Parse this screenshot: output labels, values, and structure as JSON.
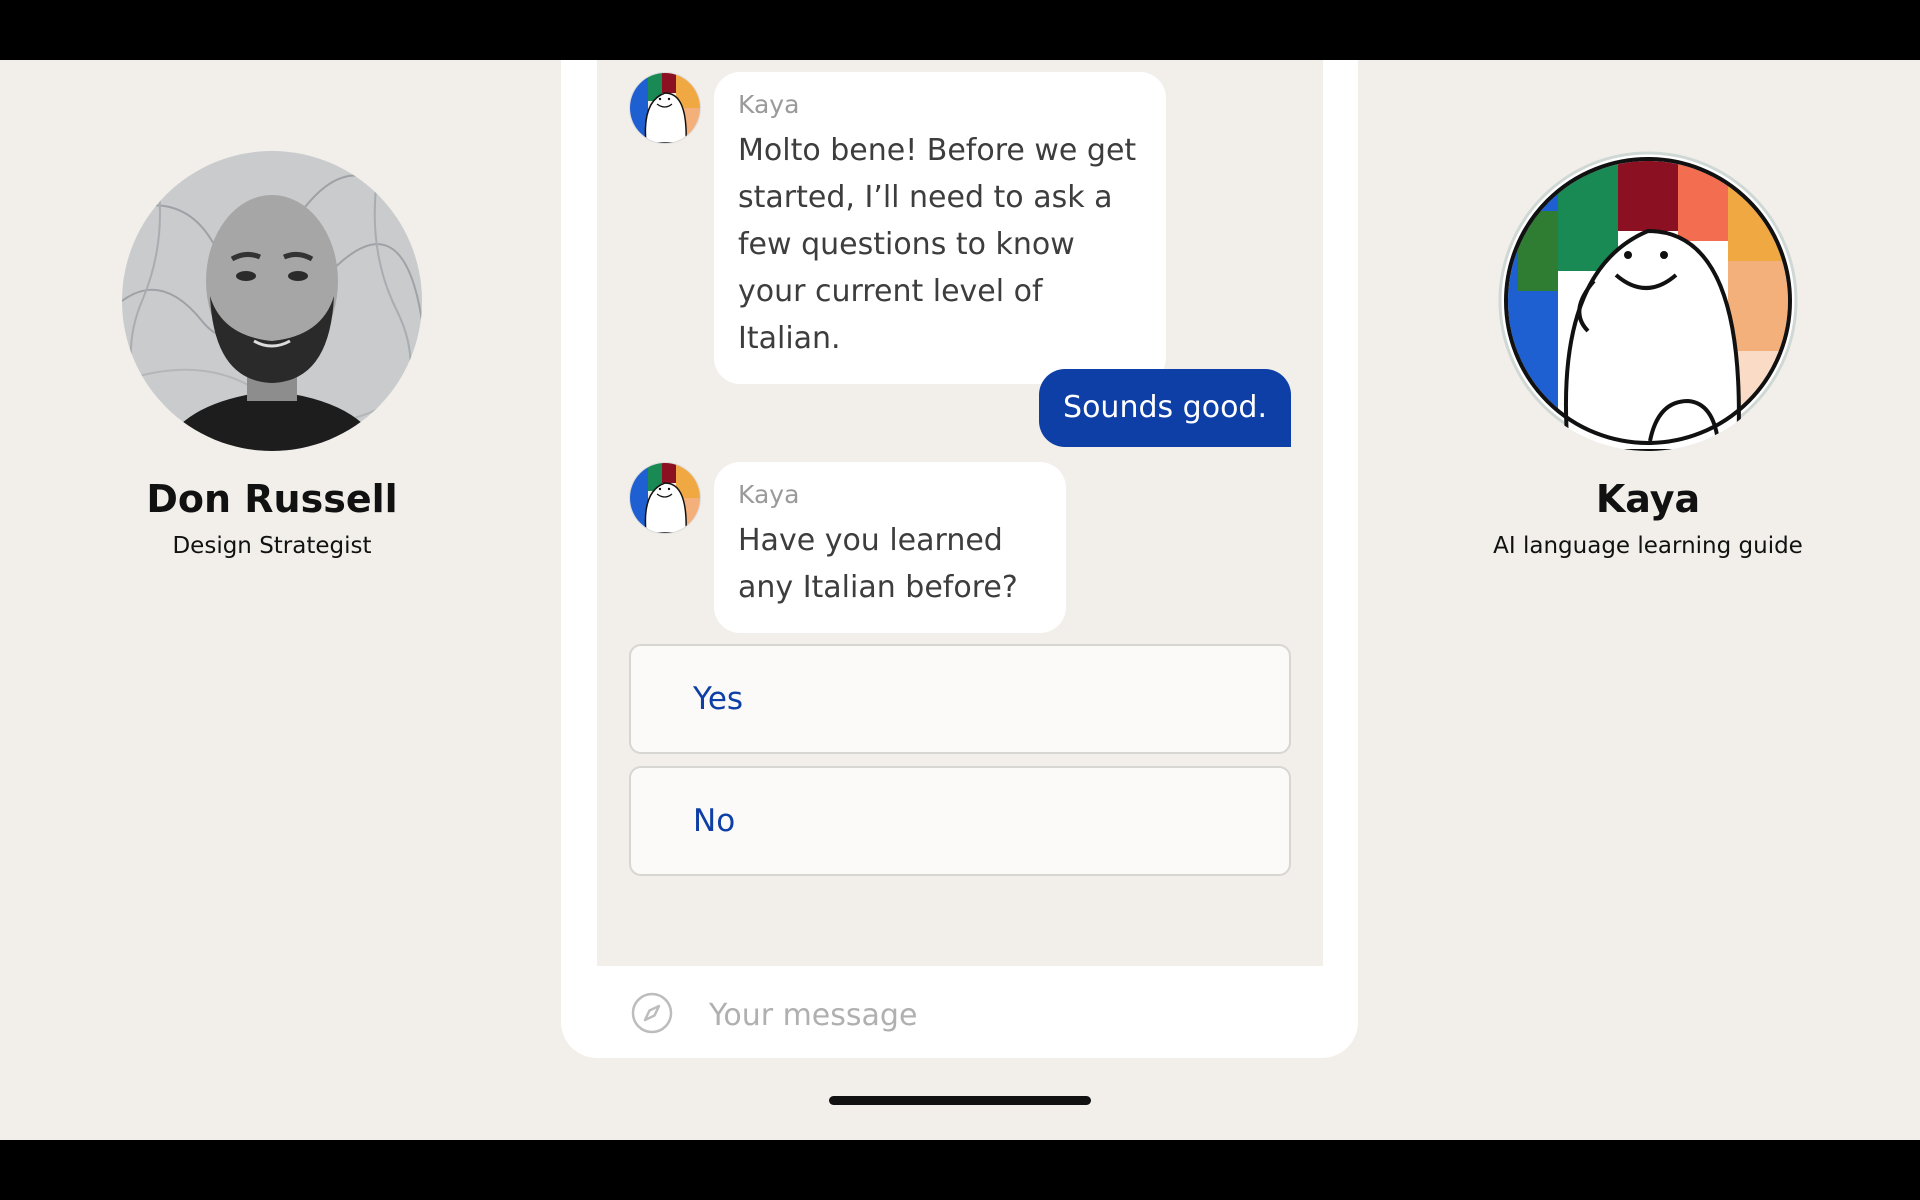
{
  "left_profile": {
    "name": "Don Russell",
    "title": "Design Strategist"
  },
  "right_profile": {
    "name": "Kaya",
    "title": "AI language learning guide"
  },
  "chat": {
    "messages": [
      {
        "sender": "Kaya",
        "text": "Molto bene! Before we get started, I’ll need to ask a few questions to know your current level of Italian."
      },
      {
        "sender": "user",
        "text": "Sounds good."
      },
      {
        "sender": "Kaya",
        "text": "Have you learned any Italian before?"
      }
    ],
    "choices": [
      "Yes",
      "No"
    ]
  },
  "composer": {
    "placeholder": "Your message",
    "icon": "compass-icon"
  },
  "colors": {
    "accent": "#0d3fa6",
    "background": "#f2efeb",
    "bubble": "#ffffff"
  }
}
